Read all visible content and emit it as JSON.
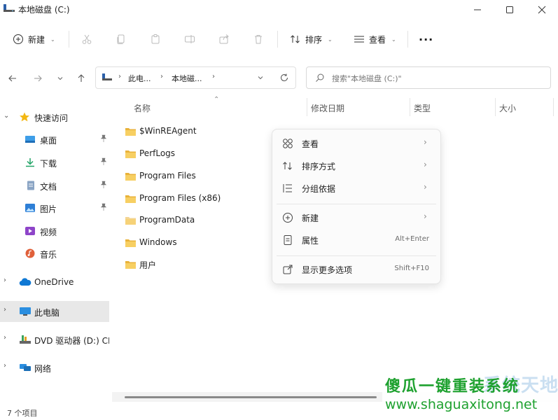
{
  "window": {
    "title": "本地磁盘 (C:)"
  },
  "toolbar": {
    "new_label": "新建",
    "sort_label": "排序",
    "view_label": "查看",
    "more_label": "···"
  },
  "address": {
    "crumbs": [
      "此电...",
      "本地磁..."
    ]
  },
  "search": {
    "placeholder": "搜索\"本地磁盘 (C:)\""
  },
  "sidebar": {
    "quick_access": "快速访问",
    "quick_items": [
      {
        "label": "桌面",
        "icon": "desktop-icon"
      },
      {
        "label": "下载",
        "icon": "download-icon"
      },
      {
        "label": "文档",
        "icon": "document-icon"
      },
      {
        "label": "图片",
        "icon": "pictures-icon"
      },
      {
        "label": "视频",
        "icon": "video-icon"
      },
      {
        "label": "音乐",
        "icon": "music-icon"
      }
    ],
    "onedrive": "OneDrive",
    "this_pc": "此电脑",
    "dvd": "DVD 驱动器 (D:) CI",
    "network": "网络"
  },
  "columns": {
    "name": "名称",
    "modified": "修改日期",
    "type": "类型",
    "size": "大小"
  },
  "files": [
    "$WinREAgent",
    "PerfLogs",
    "Program Files",
    "Program Files (x86)",
    "ProgramData",
    "Windows",
    "用户"
  ],
  "context_menu": {
    "view": "查看",
    "sort": "排序方式",
    "group": "分组依据",
    "new": "新建",
    "properties": "属性",
    "properties_shortcut": "Alt+Enter",
    "more_options": "显示更多选项",
    "more_options_shortcut": "Shift+F10"
  },
  "status": {
    "item_count": "7 个项目"
  },
  "watermark": {
    "cn": "傻瓜一键重装系统",
    "cn_ghost": "系统天地",
    "url": "www.shaguaxitong.net"
  },
  "colors": {
    "folder": "#f2c14e",
    "accent": "#0067c0",
    "watermark_green": "#1ea12f"
  }
}
